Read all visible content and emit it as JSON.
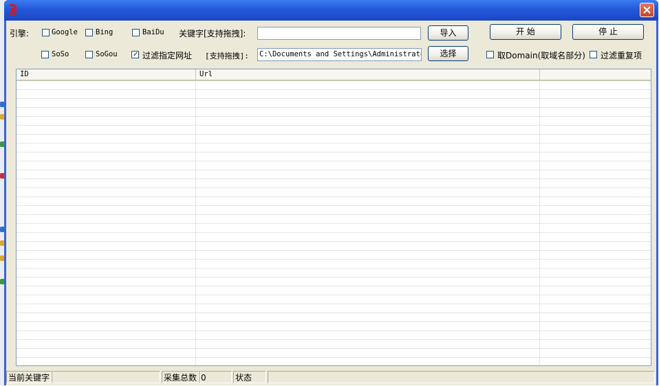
{
  "window": {
    "title": "",
    "accent": "#2458d9",
    "icons": {
      "app": "app-logo-icon",
      "close": "close-icon"
    }
  },
  "engine": {
    "label": "引擎:",
    "options": [
      {
        "label": "Google",
        "checked": false
      },
      {
        "label": "Bing",
        "checked": false
      },
      {
        "label": "BaiDu",
        "checked": false
      },
      {
        "label": "SoSo",
        "checked": false
      },
      {
        "label": "SoGou",
        "checked": false
      }
    ]
  },
  "filter_url": {
    "label": "过滤指定网址",
    "checked": true
  },
  "keyword": {
    "label": "关键字[支持拖拽]:",
    "value": ""
  },
  "path": {
    "label": "[支持拖拽]:",
    "value": "C:\\Documents and Settings\\Administrator"
  },
  "buttons": {
    "import": "导入",
    "select": "选择",
    "start": "开 始",
    "stop": "停 止"
  },
  "options": {
    "domain": {
      "label": "取Domain(取域名部分)",
      "checked": false
    },
    "dedupe": {
      "label": "过滤重复项",
      "checked": false
    }
  },
  "list": {
    "columns": [
      "ID",
      "Url",
      ""
    ],
    "rows": []
  },
  "status": {
    "keyword_label": "当前关键字",
    "keyword_value": "",
    "total_label": "采集总数",
    "total_value": "0",
    "state_label": "状态",
    "state_value": ""
  }
}
